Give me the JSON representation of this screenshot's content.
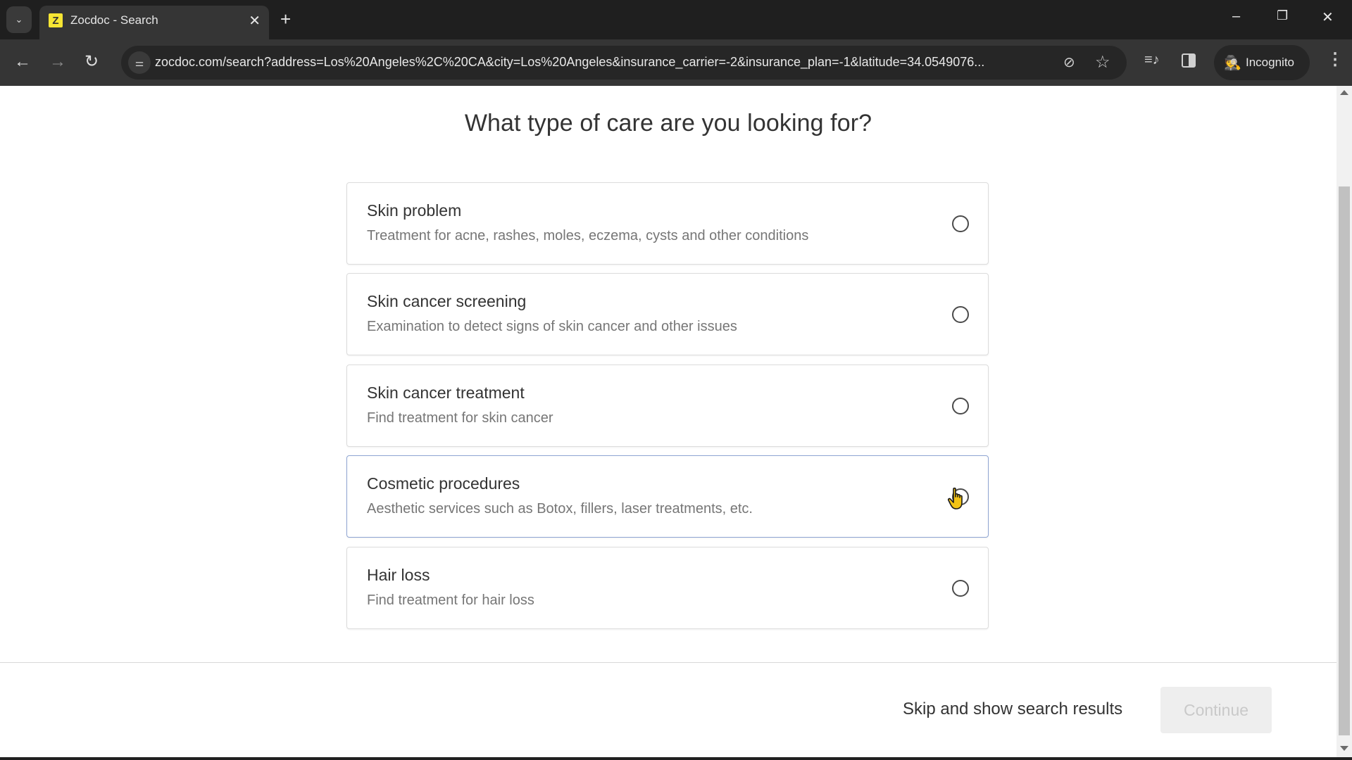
{
  "browser": {
    "tab": {
      "favicon": "Z",
      "title": "Zocdoc - Search",
      "close": "✕"
    },
    "tab_search": "⌄",
    "new_tab": "+",
    "window_controls": {
      "minimize": "–",
      "restore": "❐",
      "close": "✕"
    },
    "nav": {
      "back": "←",
      "forward": "→",
      "reload": "↻"
    },
    "site_info_icon": "⚌",
    "url": "zocdoc.com/search?address=Los%20Angeles%2C%20CA&city=Los%20Angeles&insurance_carrier=-2&insurance_plan=-1&latitude=34.0549076...",
    "eye_off_icon": "⊘",
    "star_icon": "☆",
    "media_icon": "≡♪",
    "incognito": {
      "icon": "🕵",
      "label": "Incognito"
    },
    "menu_icon": "⋮"
  },
  "page": {
    "heading": "What type of care are you looking for?",
    "options": [
      {
        "title": "Skin problem",
        "description": "Treatment for acne, rashes, moles, eczema, cysts and other conditions",
        "selected": false
      },
      {
        "title": "Skin cancer screening",
        "description": "Examination to detect signs of skin cancer and other issues",
        "selected": false
      },
      {
        "title": "Skin cancer treatment",
        "description": "Find treatment for skin cancer",
        "selected": false
      },
      {
        "title": "Cosmetic procedures",
        "description": "Aesthetic services such as Botox, fillers, laser treatments, etc.",
        "selected": false,
        "hovered": true
      },
      {
        "title": "Hair loss",
        "description": "Find treatment for hair loss",
        "selected": false
      }
    ],
    "footer": {
      "skip_label": "Skip and show search results",
      "continue_label": "Continue",
      "continue_enabled": false
    }
  },
  "colors": {
    "hover_border": "#8ea4d2",
    "favicon_bg": "#f6e533",
    "cursor_fill": "#f2c316"
  }
}
